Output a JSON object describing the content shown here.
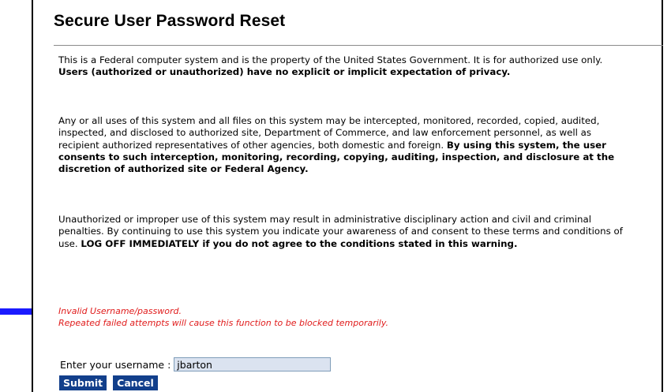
{
  "page": {
    "title": "Secure User Password Reset"
  },
  "notice": {
    "p1_normal": "This is a Federal computer system and is the property of the United States Government. It is for authorized use only. ",
    "p1_bold": "Users (authorized or unauthorized) have no explicit or implicit expectation of privacy.",
    "p2_normal": "Any or all uses of this system and all files on this system may be intercepted, monitored, recorded, copied, audited, inspected, and disclosed to authorized site, Department of Commerce, and law enforcement personnel, as well as recipient authorized representatives of other agencies, both domestic and foreign. ",
    "p2_bold": "By using this system, the user consents to such interception, monitoring, recording, copying, auditing, inspection, and disclosure at the discretion of authorized site or Federal Agency.",
    "p3_normal": "Unauthorized or improper use of this system may result in administrative disciplinary action and civil and criminal penalties. By continuing to use this system you indicate your awareness of and consent to these terms and conditions of use. ",
    "p3_bold": "LOG OFF IMMEDIATELY if you do not agree to the conditions stated in this warning."
  },
  "errors": {
    "line1": "Invalid Username/password.",
    "line2": "Repeated failed attempts will cause this function to be blocked temporarily."
  },
  "form": {
    "username_label": "Enter your username :",
    "username_value": "jbarton",
    "submit_label": "Submit",
    "cancel_label": "Cancel"
  },
  "colors": {
    "error_text": "#e01b1b",
    "button_bg": "#123f8b",
    "arrow": "#1a1aff",
    "input_bg": "#dbe3f0"
  },
  "icons": {
    "arrow": "right-arrow-icon"
  }
}
